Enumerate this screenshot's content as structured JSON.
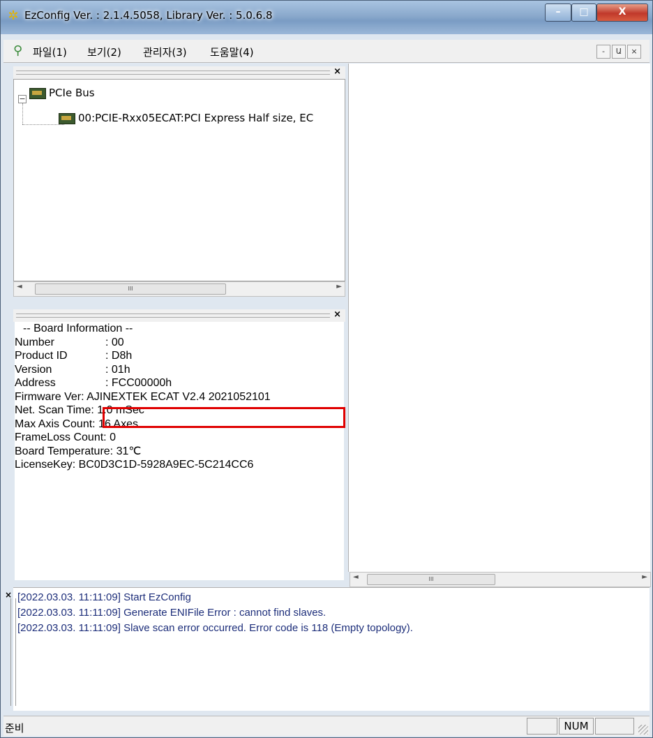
{
  "window": {
    "title": "EzConfig Ver. : 2.1.4.5058, Library Ver. :  5.0.6.8",
    "min_label": "–",
    "max_label": "□",
    "close_label": "X"
  },
  "menu": {
    "items": [
      "파일(1)",
      "보기(2)",
      "관리자(3)",
      "도움말(4)"
    ],
    "mdi": [
      "-",
      "Ա",
      "×"
    ]
  },
  "tree": {
    "root_label": "PCIe Bus",
    "expander": "−",
    "child_label": "00:PCIE-Rxx05ECAT:PCI Express Half size, EC"
  },
  "board_info": {
    "header": "-- Board Information --",
    "rows": [
      {
        "label": "Number      ",
        "value": ": 00"
      },
      {
        "label": "Product ID    ",
        "value": ": D8h"
      },
      {
        "label": "Version       ",
        "value": ": 01h"
      },
      {
        "label": "Address      ",
        "value": ": FCC00000h"
      },
      {
        "label": "Firmware Ver ",
        "value": ": AJINEXTEK ECAT V2.4 2021052101"
      },
      {
        "label": "Net. Scan Time ",
        "value": ": 1.0 mSec"
      },
      {
        "label": "Max Axis Count  ",
        "value": ": 16 Axes"
      },
      {
        "label": "FrameLoss Count ",
        "value": ": 0"
      },
      {
        "label": "Board Temperature ",
        "value": ": 31℃"
      },
      {
        "label": "LicenseKey ",
        "value": ": BC0D3C1D-5928A9EC-5C214CC6"
      }
    ]
  },
  "log": {
    "close": "×",
    "lines": [
      "[2022.03.03. 11:11:09] Start EzConfig",
      "[2022.03.03. 11:11:09] Generate ENIFile Error : cannot find slaves.",
      "[2022.03.03. 11:11:09] Slave scan error occurred. Error code is 118 (Empty topology)."
    ]
  },
  "status": {
    "text": "준비",
    "num": "NUM"
  },
  "scroll": {
    "left_arrow": "◄",
    "right_arrow": "►",
    "thumb_mark": "III"
  },
  "pane": {
    "close": "×"
  }
}
